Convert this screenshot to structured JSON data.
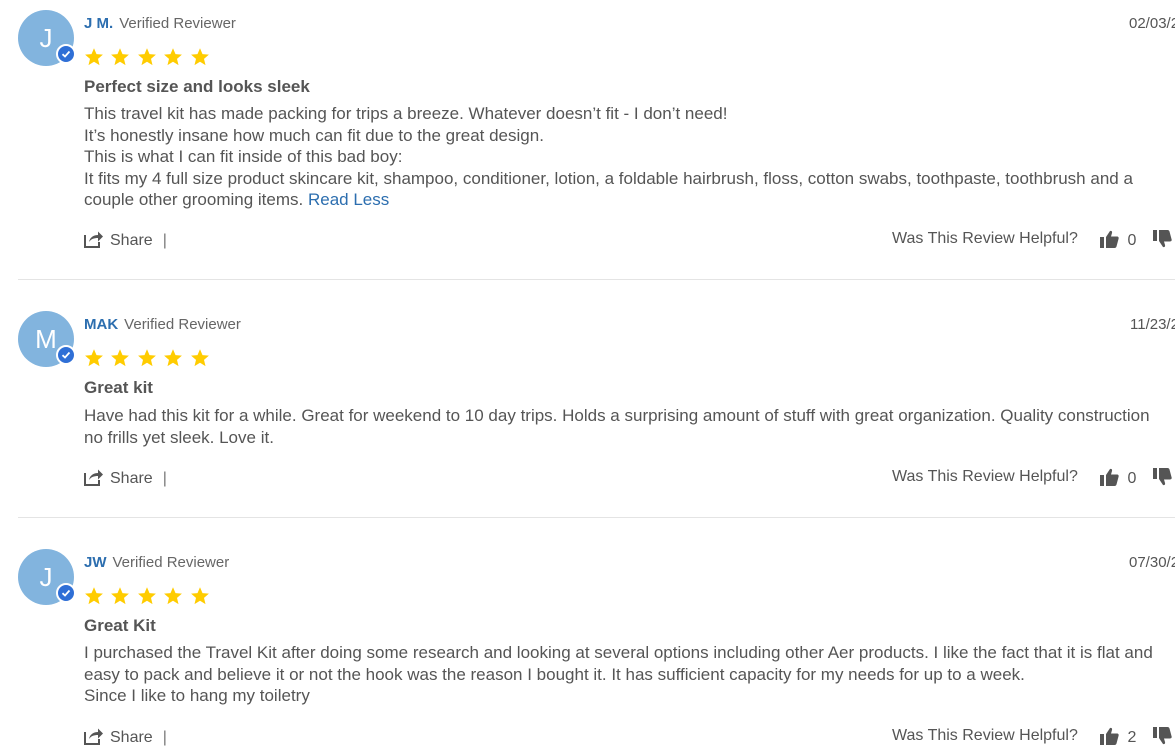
{
  "reviews": [
    {
      "avatar_letter": "J",
      "name": "J M.",
      "verified_label": "Verified Reviewer",
      "date": "02/03/2",
      "rating": 5,
      "title": "Perfect size and looks sleek",
      "body_lines": [
        "This travel kit has made packing for trips a breeze. Whatever doesn’t fit - I don’t need!",
        "It’s honestly insane how much can fit due to the great design.",
        "This is what I can fit inside of this bad boy:",
        "It fits my 4 full size product skincare kit, shampoo, conditioner, lotion, a foldable hairbrush, floss, cotton swabs, toothpaste, toothbrush and a",
        "couple other grooming items."
      ],
      "read_less": "Read Less",
      "share_label": "Share",
      "separator": "|",
      "helpful_label": "Was This Review Helpful?",
      "up_count": "0"
    },
    {
      "avatar_letter": "M",
      "name": "MAK",
      "verified_label": "Verified Reviewer",
      "date": "11/23/2",
      "rating": 5,
      "title": "Great kit",
      "body_lines": [
        "Have had this kit for a while. Great for weekend to 10 day trips. Holds a surprising amount of stuff with great organization. Quality construction",
        "no frills yet sleek. Love it."
      ],
      "share_label": "Share",
      "separator": "|",
      "helpful_label": "Was This Review Helpful?",
      "up_count": "0"
    },
    {
      "avatar_letter": "J",
      "name": "JW",
      "verified_label": "Verified Reviewer",
      "date": "07/30/2",
      "rating": 5,
      "title": "Great Kit",
      "body_lines": [
        "I purchased the Travel Kit after doing some research and looking at several options including other Aer products. I like the fact that it is flat and",
        "easy to pack and believe it or not the hook was the reason I bought it. It has sufficient capacity for my needs for up to a week.",
        "Since I like to hang my toiletry"
      ],
      "share_label": "Share",
      "separator": "|",
      "helpful_label": "Was This Review Helpful?",
      "up_count": "2"
    }
  ],
  "colors": {
    "accent": "#2c6eaf",
    "avatar": "#82b4de",
    "badge": "#2f6fd6",
    "star": "#ffcc00",
    "text": "#555555"
  }
}
